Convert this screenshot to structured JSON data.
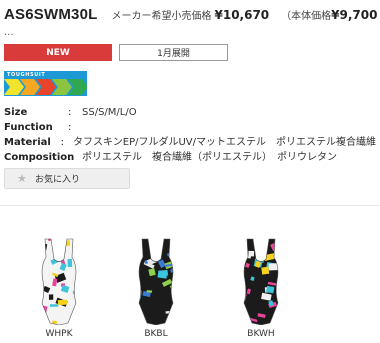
{
  "product": {
    "model": "AS6SWM30L",
    "msrp_label": "メーカー希望小売価格",
    "msrp_price": "¥10,670",
    "base_price_open": "（本体価格",
    "base_price_value": "¥9,700",
    "base_price_close": "）",
    "ellipsis": "..."
  },
  "badges": {
    "new": "NEW",
    "release": "1月展開"
  },
  "logo": {
    "text": "TOUGHSUIT",
    "stripe_colors": [
      "#f2e32c",
      "#f5a623",
      "#e8442b",
      "#8bc53f",
      "#2fa84f"
    ]
  },
  "specs": [
    {
      "label": "Size",
      "value": "SS/S/M/L/O"
    },
    {
      "label": "Function",
      "value": ""
    },
    {
      "label": "Material",
      "value": "タフスキンEP/フルダルUV/マットエステル　ポリエステル複合繊維"
    },
    {
      "label": "Composition",
      "value": "ポリエステル　複合繊維（ポリエステル）　ポリウレタン"
    }
  ],
  "favorite": {
    "label": "お気に入り",
    "icon": "star-icon"
  },
  "colors": [
    {
      "code": "WHPK",
      "body": "#f4f4f4",
      "accents": [
        "#e8449a",
        "#f5d21c",
        "#3ec4d8",
        "#1a1a1a"
      ]
    },
    {
      "code": "BKBL",
      "body": "#1b1b1b",
      "accents": [
        "#37c6e0",
        "#e8e8e8",
        "#8fd14f",
        "#3a7bd5"
      ]
    },
    {
      "code": "BKWH",
      "body": "#1b1b1b",
      "accents": [
        "#e8449a",
        "#f5d21c",
        "#3ec4d8",
        "#f0f0f0"
      ]
    }
  ]
}
